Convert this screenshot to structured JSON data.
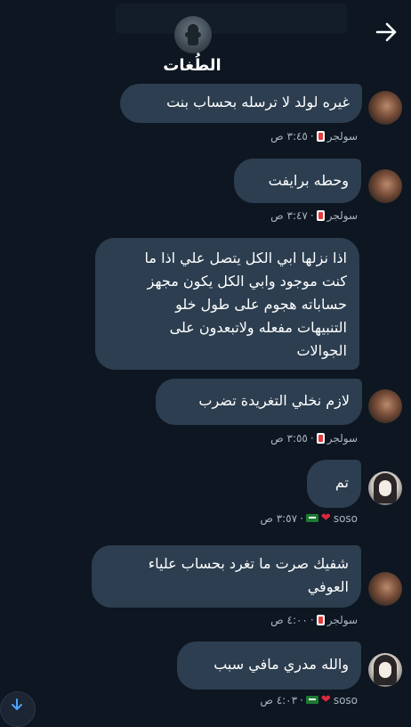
{
  "header": {
    "title": "الطُغات"
  },
  "messages": [
    {
      "text": "غيره لولد لا ترسله بحساب بنت",
      "sender": "سولجر",
      "time": "٣:٤٥ ص"
    },
    {
      "text": "وحطه برايفت",
      "sender": "سولجر",
      "time": "٣:٤٧ ص"
    },
    {
      "text": "اذا نزلها ابي الكل يتصل علي اذا ما\nكنت موجود وابي الكل يكون مجهز\nحساباته هجوم على طول خلو\nالتنبيهات مفعله ولاتبعدون على\nالجوالات",
      "sender": "",
      "time": ""
    },
    {
      "text": "لازم نخلي التغريدة تضرب",
      "sender": "سولجر",
      "time": "٣:٥٥ ص"
    },
    {
      "text": "تم",
      "sender": "soso",
      "time": "٣:٥٧ ص"
    },
    {
      "text": "شفيك صرت ما تغرد بحساب علياء\nالعوفي",
      "sender": "سولجر",
      "time": "٤:٠٠ ص"
    },
    {
      "text": "والله مدري مافي سبب",
      "sender": "soso",
      "time": "٤:٠٣ ص"
    }
  ],
  "icons": {
    "back": "arrow-right-icon",
    "scroll": "arrow-down-icon"
  },
  "colors": {
    "background": "#0d1621",
    "bubble": "#2c3e50",
    "meta": "#aab6c2"
  }
}
